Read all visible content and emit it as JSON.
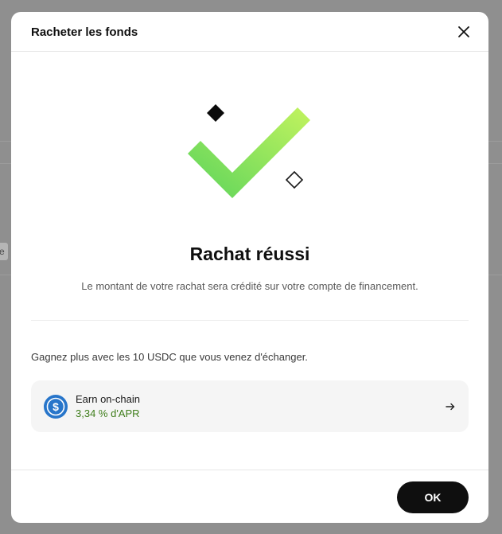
{
  "background": {
    "chip_text": "e"
  },
  "modal": {
    "title": "Racheter les fonds",
    "close_icon": "close-icon"
  },
  "hero": {
    "icon": "success-checkmark-icon",
    "check_gradient": [
      "#b8f05a",
      "#5ed65e"
    ]
  },
  "result": {
    "title": "Rachat réussi",
    "subtitle": "Le montant de votre rachat sera crédité sur votre compte de financement."
  },
  "promo": {
    "text": "Gagnez plus avec les 10 USDC que vous venez d'échanger."
  },
  "earn_card": {
    "icon": "usdc-icon",
    "title": "Earn on-chain",
    "apr": "3,34 % d'APR",
    "apr_color": "#3e7d1a",
    "usdc_color": "#2775ca",
    "arrow_icon": "arrow-right-icon"
  },
  "footer": {
    "ok_label": "OK"
  }
}
